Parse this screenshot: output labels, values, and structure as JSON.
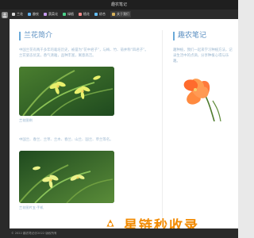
{
  "window": {
    "title": "趣农笔记"
  },
  "nav": {
    "items": [
      {
        "label": "兰花",
        "color": "#d8d8d8",
        "icon": "orchid-icon"
      },
      {
        "label": "趣农",
        "color": "#5fb2f0",
        "icon": "farm-icon"
      },
      {
        "label": "蔬菜化",
        "color": "#c79bf0",
        "icon": "vegetable-icon"
      },
      {
        "label": "绿植",
        "color": "#4ad089",
        "icon": "plant-icon"
      },
      {
        "label": "植花",
        "color": "#ff8d8d",
        "icon": "flower-icon"
      },
      {
        "label": "综合",
        "color": "#64bdf2",
        "icon": "misc-icon"
      },
      {
        "label": "关于我们",
        "color": "#d6b15b",
        "icon": "info-icon"
      }
    ]
  },
  "left": {
    "title": "兰花简介",
    "intro": "中国兰花有两千多年的栽培历史，被誉为“花中君子”，与梅、竹、菊并称“四君子”。兰花姿态优美，香气清雅，品种丰富，寓意高洁。",
    "photo1_caption": "兰花图例",
    "para2": "中国兰、春兰、兰草、兰木、春兰、山兰、国兰、草兰等名。",
    "photo2_caption": "兰花图片五·手机"
  },
  "right": {
    "title": "趣农笔记",
    "intro": "趣种植，我们一起来学习种植方法，记录生活中的点滴，分享种植心得与乐趣。"
  },
  "status": {
    "text": "© 2022 趣农笔记@2022 版权所有"
  },
  "watermark": {
    "text": "星链秒收录"
  },
  "colors": {
    "accent": "#5b8fc1",
    "brand_orange": "#f28a00"
  }
}
